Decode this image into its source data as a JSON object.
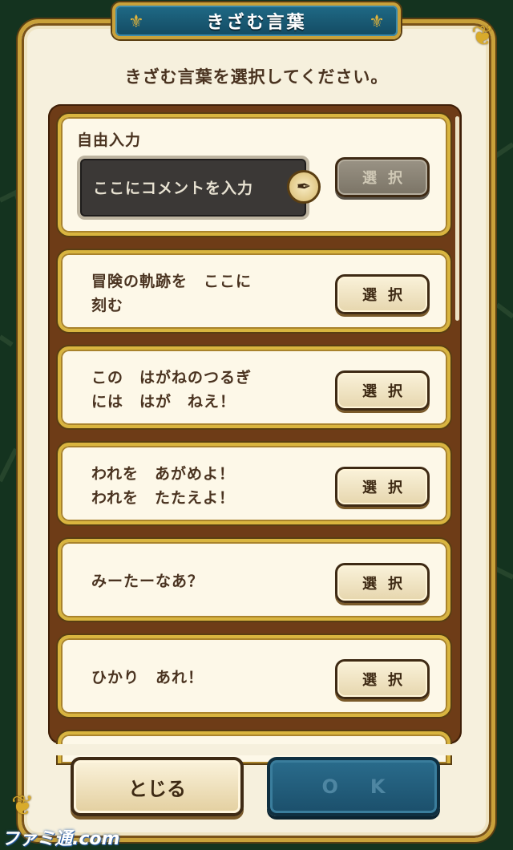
{
  "dialog": {
    "title": "きざむ言葉",
    "subtitle": "きざむ言葉を選択してください。"
  },
  "free_input": {
    "label": "自由入力",
    "placeholder": "ここにコメントを入力",
    "select_label": "選択",
    "select_enabled": false
  },
  "phrases": [
    {
      "text": "冒険の軌跡を　ここに\n刻む",
      "select_label": "選択"
    },
    {
      "text": "この　はがねのつるぎ\nには　はが　ねえ！",
      "select_label": "選択"
    },
    {
      "text": "われを　あがめよ！\nわれを　たたえよ！",
      "select_label": "選択"
    },
    {
      "text": "みーたーなあ？",
      "select_label": "選択"
    },
    {
      "text": "ひかり　あれ！",
      "select_label": "選択"
    }
  ],
  "footer": {
    "close_label": "とじる",
    "ok_label": "OK",
    "ok_enabled": false
  },
  "watermark": "ファミ通.com",
  "icons": {
    "quill": "quill-pen-icon",
    "title_ornament": "fleur-de-lis-icon"
  },
  "colors": {
    "frame_gold": "#c9a13a",
    "panel_bg": "#f6f0dd",
    "title_blue": "#1f6a86",
    "text_brown": "#4a3320"
  }
}
